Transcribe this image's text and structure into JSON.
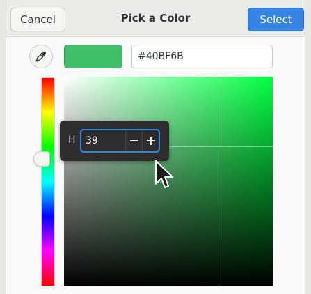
{
  "header": {
    "title": "Pick a Color",
    "cancel_label": "Cancel",
    "select_label": "Select"
  },
  "color": {
    "hex": "#40BF6B",
    "swatch_color": "#40BF6B"
  },
  "hue_popover": {
    "label": "H",
    "value": "39"
  },
  "icons": {
    "eyedropper": "eyedropper-icon",
    "decrement": "minus-icon",
    "increment": "plus-icon"
  },
  "colors": {
    "accent": "#3584e4"
  }
}
